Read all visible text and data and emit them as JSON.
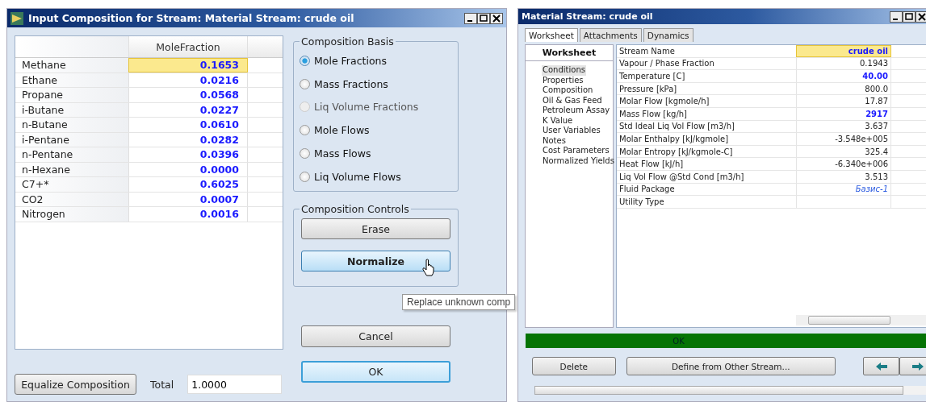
{
  "composition_window": {
    "title": "Input Composition for Stream: Material Stream: crude oil",
    "table": {
      "columns": [
        "MoleFraction"
      ],
      "rows": [
        {
          "component": "Methane",
          "value": "0.1653",
          "selected": true
        },
        {
          "component": "Ethane",
          "value": "0.0216",
          "selected": false
        },
        {
          "component": "Propane",
          "value": "0.0568",
          "selected": false
        },
        {
          "component": "i-Butane",
          "value": "0.0227",
          "selected": false
        },
        {
          "component": "n-Butane",
          "value": "0.0610",
          "selected": false
        },
        {
          "component": "i-Pentane",
          "value": "0.0282",
          "selected": false
        },
        {
          "component": "n-Pentane",
          "value": "0.0396",
          "selected": false
        },
        {
          "component": "n-Hexane",
          "value": "0.0000",
          "selected": false
        },
        {
          "component": "C7+*",
          "value": "0.6025",
          "selected": false
        },
        {
          "component": "CO2",
          "value": "0.0007",
          "selected": false
        },
        {
          "component": "Nitrogen",
          "value": "0.0016",
          "selected": false
        }
      ]
    },
    "composition_basis": {
      "title": "Composition Basis",
      "options": [
        {
          "label": "Mole Fractions",
          "selected": true,
          "disabled": false
        },
        {
          "label": "Mass Fractions",
          "selected": false,
          "disabled": false
        },
        {
          "label": "Liq Volume Fractions",
          "selected": false,
          "disabled": true
        },
        {
          "label": "Mole Flows",
          "selected": false,
          "disabled": false
        },
        {
          "label": "Mass Flows",
          "selected": false,
          "disabled": false
        },
        {
          "label": "Liq Volume Flows",
          "selected": false,
          "disabled": false
        }
      ]
    },
    "composition_controls": {
      "title": "Composition Controls",
      "buttons": [
        {
          "label": "Erase",
          "hovered": false
        },
        {
          "label": "Normalize",
          "hovered": true
        }
      ]
    },
    "tooltip": "Replace unknown comp",
    "dialog_buttons": [
      {
        "label": "Cancel",
        "default": false
      },
      {
        "label": "OK",
        "default": true
      }
    ],
    "equalize_button": "Equalize Composition",
    "total": {
      "label": "Total",
      "value": "1.0000"
    }
  },
  "stream_window": {
    "title": "Material Stream: crude oil",
    "tabs": [
      {
        "label": "Worksheet",
        "selected": true
      },
      {
        "label": "Attachments",
        "selected": false
      },
      {
        "label": "Dynamics",
        "selected": false
      }
    ],
    "sidebar": {
      "title": "Worksheet",
      "items": [
        {
          "label": "Conditions",
          "selected": true
        },
        {
          "label": "Properties",
          "selected": false
        },
        {
          "label": "Composition",
          "selected": false
        },
        {
          "label": "Oil & Gas Feed",
          "selected": false
        },
        {
          "label": "Petroleum Assay",
          "selected": false
        },
        {
          "label": "K Value",
          "selected": false
        },
        {
          "label": "User Variables",
          "selected": false
        },
        {
          "label": "Notes",
          "selected": false
        },
        {
          "label": "Cost Parameters",
          "selected": false
        },
        {
          "label": "Normalized Yields",
          "selected": false
        }
      ]
    },
    "grid": {
      "rows": [
        {
          "label": "Stream Name",
          "value": "crude oil",
          "kind": "specified",
          "selected": true
        },
        {
          "label": "Vapour / Phase Fraction",
          "value": "0.1943",
          "kind": "calculated",
          "selected": false
        },
        {
          "label": "Temperature [C]",
          "value": "40.00",
          "kind": "specified",
          "selected": false
        },
        {
          "label": "Pressure [kPa]",
          "value": "800.0",
          "kind": "calculated",
          "selected": false
        },
        {
          "label": "Molar Flow [kgmole/h]",
          "value": "17.87",
          "kind": "calculated",
          "selected": false
        },
        {
          "label": "Mass Flow [kg/h]",
          "value": "2917",
          "kind": "specified",
          "selected": false
        },
        {
          "label": "Std Ideal Liq Vol Flow [m3/h]",
          "value": "3.637",
          "kind": "calculated",
          "selected": false
        },
        {
          "label": "Molar Enthalpy [kJ/kgmole]",
          "value": "-3.548e+005",
          "kind": "calculated",
          "selected": false
        },
        {
          "label": "Molar Entropy [kJ/kgmole-C]",
          "value": "325.4",
          "kind": "calculated",
          "selected": false
        },
        {
          "label": "Heat Flow [kJ/h]",
          "value": "-6.340e+006",
          "kind": "calculated",
          "selected": false
        },
        {
          "label": "Liq Vol Flow @Std Cond [m3/h]",
          "value": "3.513",
          "kind": "calculated",
          "selected": false
        },
        {
          "label": "Fluid Package",
          "value": "Базис-1",
          "kind": "link",
          "selected": false
        },
        {
          "label": "Utility Type",
          "kind": "calculated",
          "selected": false
        }
      ]
    },
    "status": "OK",
    "buttons": [
      "Delete",
      "Define from Other Stream..."
    ]
  }
}
